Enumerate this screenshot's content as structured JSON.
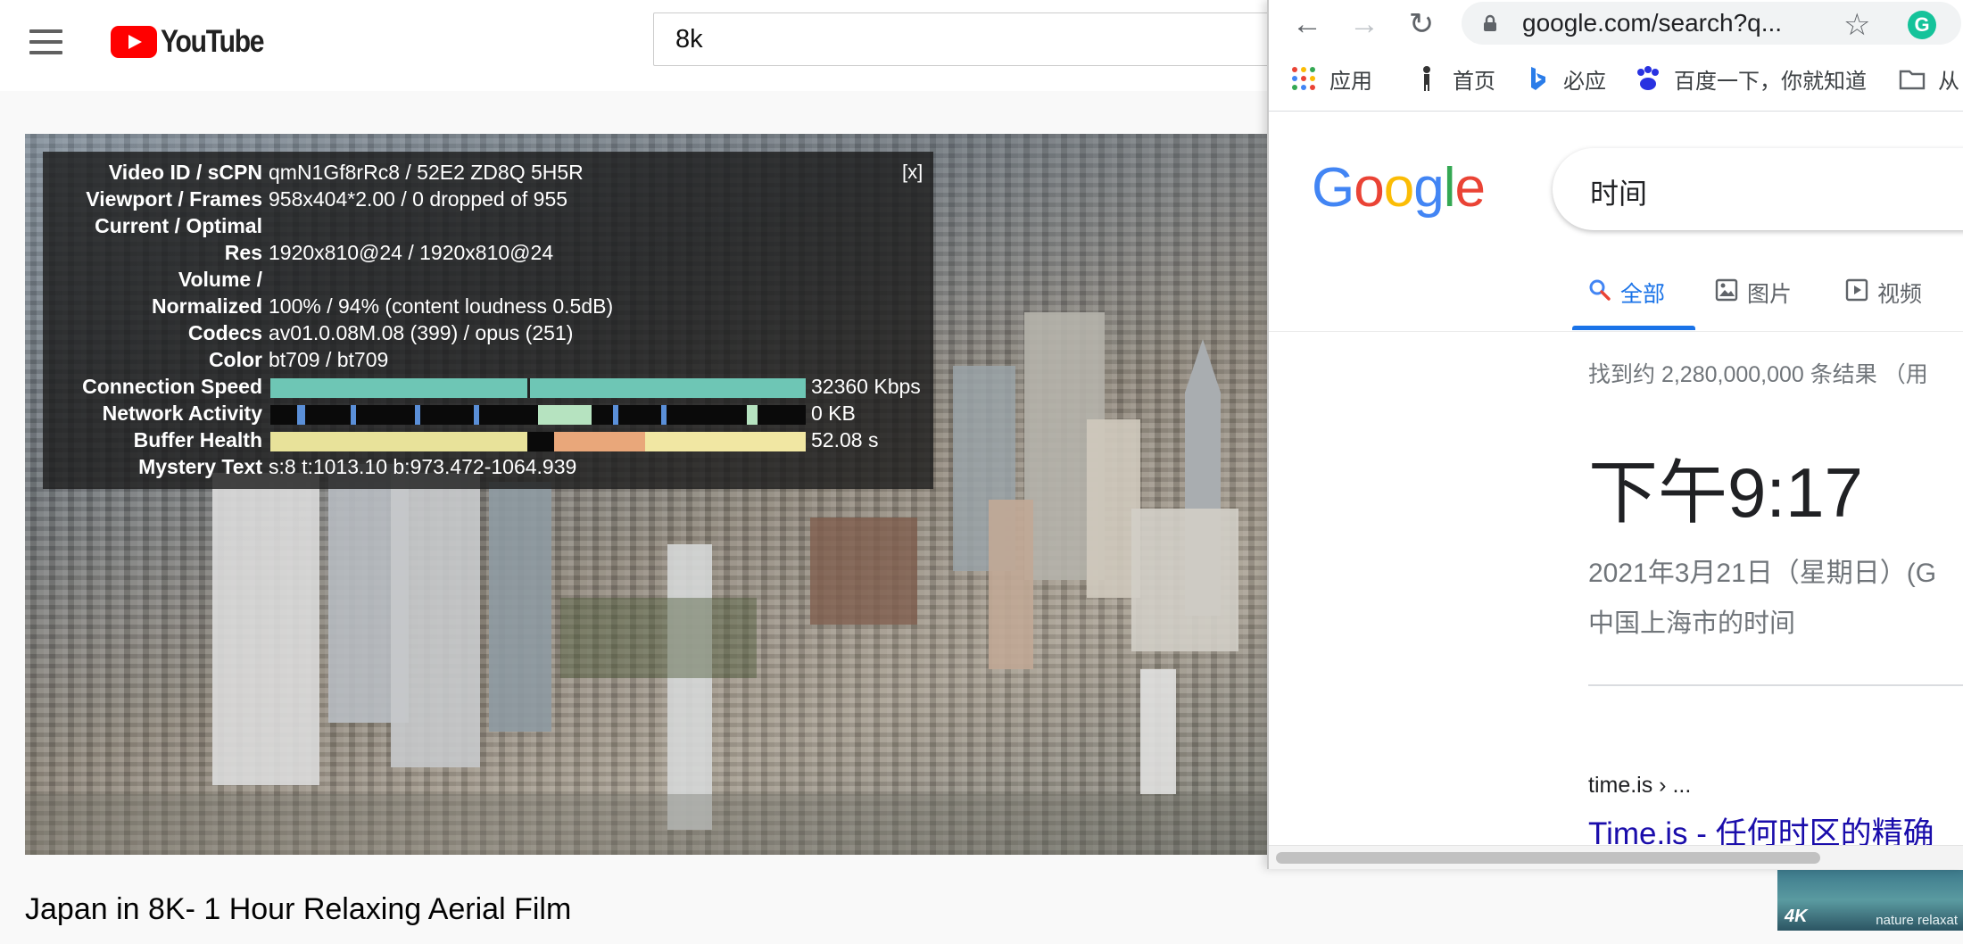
{
  "youtube": {
    "logo_text": "YouTube",
    "search_query": "8k",
    "video_title": "Japan in 8K- 1 Hour Relaxing Aerial Film",
    "stats_close": "[x]",
    "stats": [
      {
        "label": "Video ID / sCPN",
        "value": "qmN1Gf8rRc8 / 52E2 ZD8Q 5H5R"
      },
      {
        "label": "Viewport / Frames",
        "value": "958x404*2.00 / 0 dropped of 955"
      },
      {
        "label": "Current / Optimal",
        "value": ""
      },
      {
        "label": "Res",
        "value": "1920x810@24 / 1920x810@24"
      },
      {
        "label": "Volume /",
        "value": ""
      },
      {
        "label": "Normalized",
        "value": "100% / 94% (content loudness 0.5dB)"
      },
      {
        "label": "Codecs",
        "value": "av01.0.08M.08 (399) / opus (251)"
      },
      {
        "label": "Color",
        "value": "bt709 / bt709"
      },
      {
        "label": "Connection Speed",
        "value": "32360 Kbps"
      },
      {
        "label": "Network Activity",
        "value": "0 KB"
      },
      {
        "label": "Buffer Health",
        "value": "52.08 s"
      },
      {
        "label": "Mystery Text",
        "value": "s:8 t:1013.10 b:973.472-1064.939"
      }
    ],
    "thumbnail": {
      "badge": "4K",
      "brand": "nature relaxat"
    }
  },
  "chrome": {
    "url": "google.com/search?q...",
    "icons": [
      "back-icon",
      "forward-icon",
      "reload-icon",
      "lock-icon",
      "star-icon",
      "grammarly-icon"
    ],
    "grammarly_letter": "G",
    "bookmarks": [
      {
        "label": "应用",
        "icon": "apps-grid-icon"
      },
      {
        "label": "首页",
        "icon": "home-figure-icon"
      },
      {
        "label": "必应",
        "icon": "bing-icon"
      },
      {
        "label": "百度一下，你就知道",
        "icon": "baidu-paw-icon"
      },
      {
        "label": "从",
        "icon": "folder-icon"
      }
    ]
  },
  "google": {
    "logo": "Google",
    "logo_colors": [
      "#4285F4",
      "#EA4335",
      "#FBBC05",
      "#4285F4",
      "#34A853",
      "#EA4335"
    ],
    "query": "时间",
    "tabs": [
      {
        "label": "全部",
        "icon": "search-icon",
        "active": true
      },
      {
        "label": "图片",
        "icon": "image-icon",
        "active": false
      },
      {
        "label": "视频",
        "icon": "video-icon",
        "active": false
      }
    ],
    "result_stats": "找到约 2,280,000,000 条结果 （用",
    "time_prefix": "下午",
    "time": "9:17",
    "date": "2021年3月21日（星期日）(G",
    "location": "中国上海市的时间",
    "cite": "time.is › ...",
    "result_title": "Time.is - 任何时区的精确"
  }
}
